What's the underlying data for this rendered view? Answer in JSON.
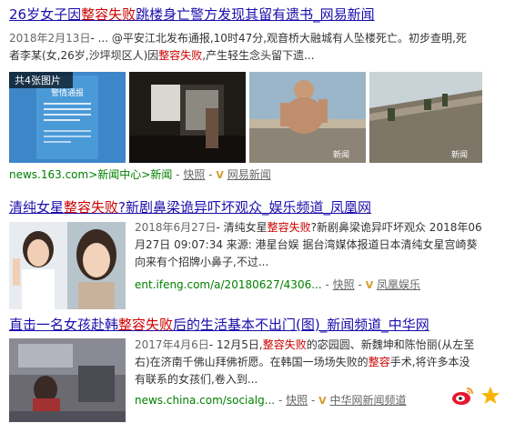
{
  "results": [
    {
      "title_pre": "26岁女子因",
      "title_hl": "整容失败",
      "title_post": "跳楼身亡警方发现其留有遗书_网易新闻",
      "date": "2018年2月13日",
      "abstract_line1_pre": "-  ... @平安江北发布通报,10时47分,观音桥大融城有人坠楼死亡。初步查明,死",
      "abstract_line2_pre": "者李某(女,26岁,沙坪坝区人)因",
      "abstract_line2_hl": "整容失败",
      "abstract_line2_post": ",产生轻生念头留下遗...",
      "image_count_label": "共4张图片",
      "thumb1_text": "警情通报",
      "thumb3_watermark": "新闻",
      "thumb4_watermark": "新闻",
      "src_url": "news.163.com>新闻中心>新闻",
      "src_sep1": "-",
      "snapshot": "快照",
      "src_sep2": "-",
      "v": "V",
      "site_name": "网易新闻"
    },
    {
      "title_pre": "清纯女星",
      "title_hl": "整容失败",
      "title_post": "?新剧鼻梁诡异吓坏观众_娱乐频道_凤凰网",
      "date": "2018年6月27日",
      "abstract_line1_pre": "- 清纯女星",
      "abstract_line1_hl": "整容失败",
      "abstract_line1_post": "?新剧鼻梁诡异吓坏观众 2018年06",
      "abstract_line2": "月27日 09:07:34 来源: 港星台娱 据台湾媒体报道日本清纯女星宫崎葵",
      "abstract_line3": "向来有个招牌小鼻子,不过...",
      "src_url": "ent.ifeng.com/a/20180627/4306...",
      "src_sep1": "-",
      "snapshot": "快照",
      "src_sep2": "-",
      "v": "V",
      "site_name": "凤凰娱乐"
    },
    {
      "title_pre": "直击一名女孩赴韩",
      "title_hl": "整容失败",
      "title_post": "后的生活基本不出门(图)_新闻频道_中华网",
      "date": "2017年4月6日",
      "abstract_line1_pre": "- 12月5日,",
      "abstract_line1_hl": "整容失败",
      "abstract_line1_post": "的宓园圆、新魏坤和陈怡丽(从左至",
      "abstract_line2_pre": "右)在济南千佛山拜佛祈愿。在韩国一场场失败的",
      "abstract_line2_hl": "整容",
      "abstract_line2_post": "手术,将许多本没",
      "abstract_line3": "有联系的女孩们,卷入到...",
      "src_url": "news.china.com/socialg...",
      "src_sep1": "-",
      "snapshot": "快照",
      "src_sep2": "-",
      "v": "V",
      "site_name": "中华网新闻频道"
    }
  ],
  "colors": {
    "title_link": "#1a0dab",
    "highlight": "#cc0000",
    "source_url": "#008000",
    "v_badge": "#d69b27"
  },
  "icons": {
    "weibo": "weibo-icon",
    "star": "star-icon"
  }
}
